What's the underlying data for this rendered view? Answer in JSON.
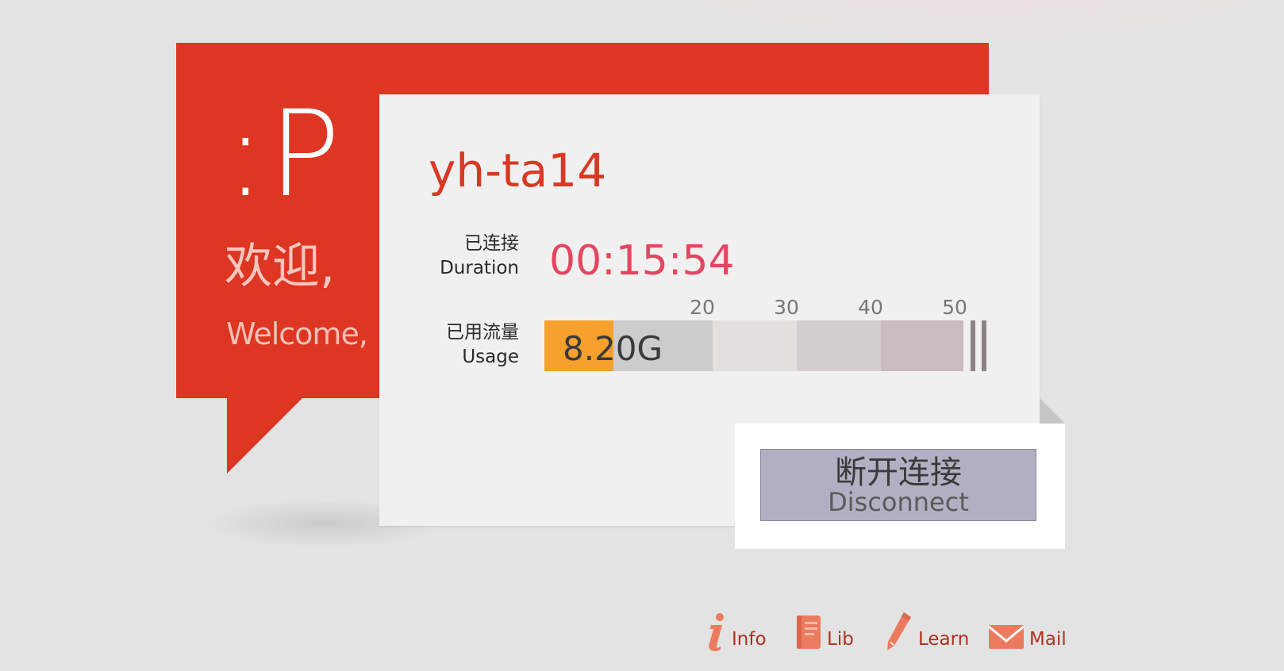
{
  "welcome": {
    "smiley": ":P",
    "greeting_cn": "欢迎,",
    "greeting_en": "Welcome,"
  },
  "account": {
    "username": "yh-ta14",
    "duration_label_cn": "已连接",
    "duration_label_en": "Duration",
    "duration_value": "00:15:54",
    "usage_label_cn": "已用流量",
    "usage_label_en": "Usage",
    "usage_value": "8.20G",
    "usage_ticks": [
      "20",
      "30",
      "40",
      "50"
    ],
    "usage_fill_fraction": 0.164
  },
  "actions": {
    "disconnect_cn": "断开连接",
    "disconnect_en": "Disconnect"
  },
  "footer": {
    "info": "Info",
    "lib": "Lib",
    "learn": "Learn",
    "mail": "Mail"
  },
  "colors": {
    "accent_red": "#dd3622",
    "duration_pink": "#e44560",
    "usage_orange": "#f6a02d",
    "button_lavender": "#b3afc3",
    "link_red": "#b0301e",
    "icon_orange": "#ec7a5f"
  },
  "icons": [
    "info-icon",
    "book-icon",
    "pencil-icon",
    "mail-icon"
  ]
}
